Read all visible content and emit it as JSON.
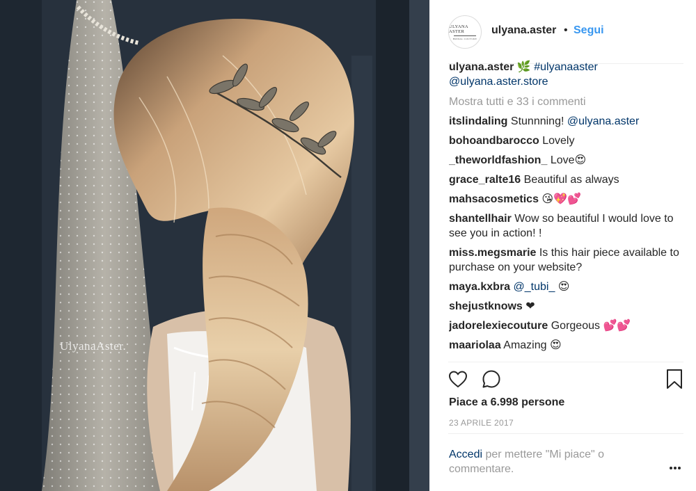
{
  "photo": {
    "watermark": "UlyanaAster."
  },
  "header": {
    "avatar_line1": "ULYANA ASTER",
    "avatar_line2": "BRIDAL COUTURE",
    "username": "ulyana.aster",
    "separator": "•",
    "follow_label": "Segui"
  },
  "caption": {
    "username": "ulyana.aster",
    "emoji": "🌿",
    "hashtag": "#ulyanaaster",
    "link": "@ulyana.aster.store"
  },
  "show_all_label": "Mostra tutti e 33 i commenti",
  "comments": [
    {
      "user": "itslindaling",
      "text": "Stunnning!",
      "mention": "@ulyana.aster",
      "after": ""
    },
    {
      "user": "bohoandbarocco",
      "text": "Lovely",
      "mention": "",
      "after": ""
    },
    {
      "user": "_theworldfashion_",
      "text": "Love😍",
      "mention": "",
      "after": ""
    },
    {
      "user": "grace_ralte16",
      "text": "Beautiful as always",
      "mention": "",
      "after": ""
    },
    {
      "user": "mahsacosmetics",
      "text": "😘💖💕",
      "mention": "",
      "after": ""
    },
    {
      "user": "shantellhair",
      "text": "Wow so beautiful I would love to see you in action! !",
      "mention": "",
      "after": ""
    },
    {
      "user": "miss.megsmarie",
      "text": "Is this hair piece available to purchase on your website?",
      "mention": "",
      "after": ""
    },
    {
      "user": "maya.kxbra",
      "text": "",
      "mention": "@_tubi_",
      "after": " 😍"
    },
    {
      "user": "shejustknows",
      "text": "❤",
      "mention": "",
      "after": ""
    },
    {
      "user": "jadorelexiecouture",
      "text": "Gorgeous 💕💕",
      "mention": "",
      "after": ""
    },
    {
      "user": "maariolaa",
      "text": "Amazing 😍",
      "mention": "",
      "after": ""
    }
  ],
  "actions": {
    "like_icon": "heart-icon",
    "comment_icon": "comment-bubble-icon",
    "save_icon": "bookmark-icon"
  },
  "likes_label": "Piace a 6.998 persone",
  "date_label": "23 APRILE 2017",
  "login_prompt": {
    "link": "Accedi",
    "text": " per mettere \"Mi piace\" o commentare."
  },
  "more_icon": "more-options-icon",
  "colors": {
    "link_blue": "#3897f0",
    "dark_link": "#003569",
    "muted": "#999999",
    "text": "#262626"
  }
}
